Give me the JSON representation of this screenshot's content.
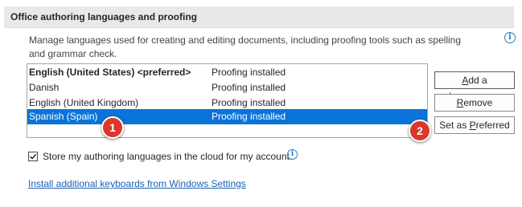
{
  "section": {
    "title": "Office authoring languages and proofing"
  },
  "description": "Manage languages used for creating and editing documents, including proofing tools such as spelling and grammar check.",
  "info_icon": "i",
  "languages": [
    {
      "name": "English (United States) <preferred>",
      "status": "Proofing installed",
      "bold": true,
      "selected": false
    },
    {
      "name": "Danish",
      "status": "Proofing installed",
      "bold": false,
      "selected": false
    },
    {
      "name": "English (United Kingdom)",
      "status": "Proofing installed",
      "bold": false,
      "selected": false
    },
    {
      "name": "Spanish (Spain)",
      "status": "Proofing installed",
      "bold": false,
      "selected": true
    }
  ],
  "buttons": {
    "add_language": {
      "mnemonic": "A",
      "rest": "dd a Language..."
    },
    "remove": {
      "mnemonic": "R",
      "rest": "emove"
    },
    "set_preferred": {
      "before": "Set as ",
      "mnemonic": "P",
      "rest": "referred"
    }
  },
  "badges": {
    "one": "1",
    "two": "2"
  },
  "cloud_option": {
    "checked": true,
    "label": "Store my authoring languages in the cloud for my account."
  },
  "link": "Install additional keyboards from Windows Settings",
  "colors": {
    "selection": "#0a74d8",
    "badge": "#d9382b",
    "link": "#1a5fb4",
    "info": "#2d7cc7"
  }
}
